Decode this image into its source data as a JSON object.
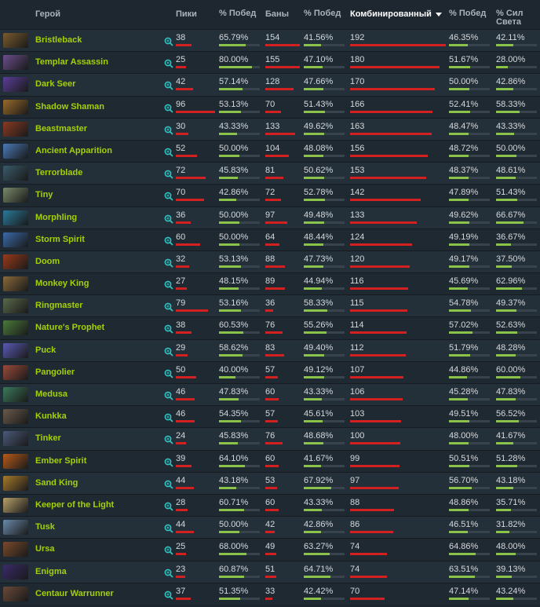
{
  "headers": {
    "hero": "Герой",
    "picks": "Пики",
    "pick_winrate": "% Побед",
    "bans": "Баны",
    "ban_winrate": "% Побед",
    "combined": "Комбинированный",
    "combined_winrate": "% Побед",
    "radiant": "% Сил Света"
  },
  "colors": {
    "hero_name": "#a4d007",
    "bar_red": "#d32121",
    "bar_green": "#8bc34a",
    "search_icon": "#2ec4c4"
  },
  "heroes": [
    {
      "name": "Bristleback",
      "portrait": "#7a5a2e",
      "picks": "38",
      "pick_wr": "65.79%",
      "bans": "154",
      "ban_wr": "41.56%",
      "combined": "192",
      "comb_wr": "46.35%",
      "radiant": "42.11%"
    },
    {
      "name": "Templar Assassin",
      "portrait": "#6b4e8c",
      "picks": "25",
      "pick_wr": "80.00%",
      "bans": "155",
      "ban_wr": "47.10%",
      "combined": "180",
      "comb_wr": "51.67%",
      "radiant": "28.00%"
    },
    {
      "name": "Dark Seer",
      "portrait": "#5a3e9a",
      "picks": "42",
      "pick_wr": "57.14%",
      "bans": "128",
      "ban_wr": "47.66%",
      "combined": "170",
      "comb_wr": "50.00%",
      "radiant": "42.86%"
    },
    {
      "name": "Shadow Shaman",
      "portrait": "#9a6a2a",
      "picks": "96",
      "pick_wr": "53.13%",
      "bans": "70",
      "ban_wr": "51.43%",
      "combined": "166",
      "comb_wr": "52.41%",
      "radiant": "58.33%"
    },
    {
      "name": "Beastmaster",
      "portrait": "#8a3a22",
      "picks": "30",
      "pick_wr": "43.33%",
      "bans": "133",
      "ban_wr": "49.62%",
      "combined": "163",
      "comb_wr": "48.47%",
      "radiant": "43.33%"
    },
    {
      "name": "Ancient Apparition",
      "portrait": "#4a7ab8",
      "picks": "52",
      "pick_wr": "50.00%",
      "bans": "104",
      "ban_wr": "48.08%",
      "combined": "156",
      "comb_wr": "48.72%",
      "radiant": "50.00%"
    },
    {
      "name": "Terrorblade",
      "portrait": "#3a5a6a",
      "picks": "72",
      "pick_wr": "45.83%",
      "bans": "81",
      "ban_wr": "50.62%",
      "combined": "153",
      "comb_wr": "48.37%",
      "radiant": "48.61%"
    },
    {
      "name": "Tiny",
      "portrait": "#7a8a6a",
      "picks": "70",
      "pick_wr": "42.86%",
      "bans": "72",
      "ban_wr": "52.78%",
      "combined": "142",
      "comb_wr": "47.89%",
      "radiant": "51.43%"
    },
    {
      "name": "Morphling",
      "portrait": "#2a7a9a",
      "picks": "36",
      "pick_wr": "50.00%",
      "bans": "97",
      "ban_wr": "49.48%",
      "combined": "133",
      "comb_wr": "49.62%",
      "radiant": "66.67%"
    },
    {
      "name": "Storm Spirit",
      "portrait": "#3a6aaa",
      "picks": "60",
      "pick_wr": "50.00%",
      "bans": "64",
      "ban_wr": "48.44%",
      "combined": "124",
      "comb_wr": "49.19%",
      "radiant": "36.67%"
    },
    {
      "name": "Doom",
      "portrait": "#9a3a1a",
      "picks": "32",
      "pick_wr": "53.13%",
      "bans": "88",
      "ban_wr": "47.73%",
      "combined": "120",
      "comb_wr": "49.17%",
      "radiant": "37.50%"
    },
    {
      "name": "Monkey King",
      "portrait": "#8a6a3a",
      "picks": "27",
      "pick_wr": "48.15%",
      "bans": "89",
      "ban_wr": "44.94%",
      "combined": "116",
      "comb_wr": "45.69%",
      "radiant": "62.96%"
    },
    {
      "name": "Ringmaster",
      "portrait": "#5a6a4a",
      "picks": "79",
      "pick_wr": "53.16%",
      "bans": "36",
      "ban_wr": "58.33%",
      "combined": "115",
      "comb_wr": "54.78%",
      "radiant": "49.37%"
    },
    {
      "name": "Nature's Prophet",
      "portrait": "#4a7a3a",
      "picks": "38",
      "pick_wr": "60.53%",
      "bans": "76",
      "ban_wr": "55.26%",
      "combined": "114",
      "comb_wr": "57.02%",
      "radiant": "52.63%"
    },
    {
      "name": "Puck",
      "portrait": "#5a5ab8",
      "picks": "29",
      "pick_wr": "58.62%",
      "bans": "83",
      "ban_wr": "49.40%",
      "combined": "112",
      "comb_wr": "51.79%",
      "radiant": "48.28%"
    },
    {
      "name": "Pangolier",
      "portrait": "#9a4a3a",
      "picks": "50",
      "pick_wr": "40.00%",
      "bans": "57",
      "ban_wr": "49.12%",
      "combined": "107",
      "comb_wr": "44.86%",
      "radiant": "60.00%"
    },
    {
      "name": "Medusa",
      "portrait": "#3a7a5a",
      "picks": "46",
      "pick_wr": "47.83%",
      "bans": "60",
      "ban_wr": "43.33%",
      "combined": "106",
      "comb_wr": "45.28%",
      "radiant": "47.83%"
    },
    {
      "name": "Kunkka",
      "portrait": "#6a5a4a",
      "picks": "46",
      "pick_wr": "54.35%",
      "bans": "57",
      "ban_wr": "45.61%",
      "combined": "103",
      "comb_wr": "49.51%",
      "radiant": "56.52%"
    },
    {
      "name": "Tinker",
      "portrait": "#4a5a7a",
      "picks": "24",
      "pick_wr": "45.83%",
      "bans": "76",
      "ban_wr": "48.68%",
      "combined": "100",
      "comb_wr": "48.00%",
      "radiant": "41.67%"
    },
    {
      "name": "Ember Spirit",
      "portrait": "#b85a1a",
      "picks": "39",
      "pick_wr": "64.10%",
      "bans": "60",
      "ban_wr": "41.67%",
      "combined": "99",
      "comb_wr": "50.51%",
      "radiant": "51.28%"
    },
    {
      "name": "Sand King",
      "portrait": "#a87a2a",
      "picks": "44",
      "pick_wr": "43.18%",
      "bans": "53",
      "ban_wr": "67.92%",
      "combined": "97",
      "comb_wr": "56.70%",
      "radiant": "43.18%"
    },
    {
      "name": "Keeper of the Light",
      "portrait": "#b8a06a",
      "picks": "28",
      "pick_wr": "60.71%",
      "bans": "60",
      "ban_wr": "43.33%",
      "combined": "88",
      "comb_wr": "48.86%",
      "radiant": "35.71%"
    },
    {
      "name": "Tusk",
      "portrait": "#6a8aaa",
      "picks": "44",
      "pick_wr": "50.00%",
      "bans": "42",
      "ban_wr": "42.86%",
      "combined": "86",
      "comb_wr": "46.51%",
      "radiant": "31.82%"
    },
    {
      "name": "Ursa",
      "portrait": "#7a4a2a",
      "picks": "25",
      "pick_wr": "68.00%",
      "bans": "49",
      "ban_wr": "63.27%",
      "combined": "74",
      "comb_wr": "64.86%",
      "radiant": "48.00%"
    },
    {
      "name": "Enigma",
      "portrait": "#3a2a6a",
      "picks": "23",
      "pick_wr": "60.87%",
      "bans": "51",
      "ban_wr": "64.71%",
      "combined": "74",
      "comb_wr": "63.51%",
      "radiant": "39.13%"
    },
    {
      "name": "Centaur Warrunner",
      "portrait": "#6a4a3a",
      "picks": "37",
      "pick_wr": "51.35%",
      "bans": "33",
      "ban_wr": "42.42%",
      "combined": "70",
      "comb_wr": "47.14%",
      "radiant": "43.24%"
    }
  ]
}
